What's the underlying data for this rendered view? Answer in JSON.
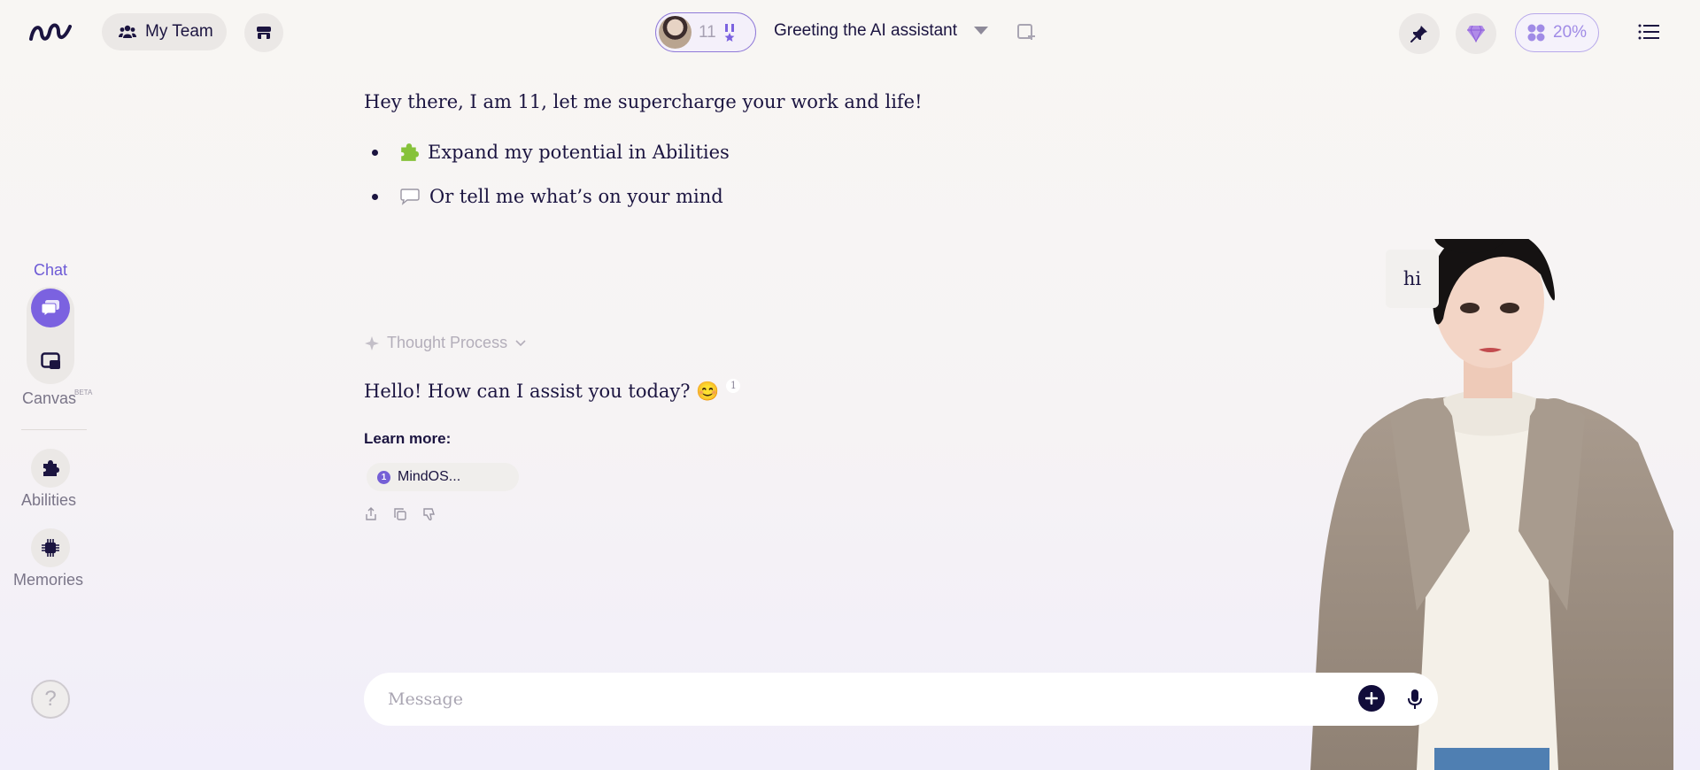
{
  "topbar": {
    "team_label": "My Team",
    "agent_count": "11",
    "conversation_title": "Greeting the AI assistant",
    "credits_percent": "20%"
  },
  "rail": {
    "chat_label": "Chat",
    "canvas_label": "Canvas",
    "canvas_badge": "BETA",
    "abilities_label": "Abilities",
    "memories_label": "Memories",
    "help_label": "?"
  },
  "chat": {
    "greeting": "Hey there, I am 11, let me supercharge your work and life!",
    "bullets": [
      {
        "icon": "puzzle-icon",
        "text": "Expand my potential in Abilities"
      },
      {
        "icon": "speech-bubble-icon",
        "text": "Or tell me what’s on your mind"
      }
    ],
    "thought_process_label": "Thought Process",
    "reply": "Hello! How can I assist you today? 😊",
    "reply_citation": "1",
    "learn_more_label": "Learn more:",
    "sources": [
      {
        "num": "1",
        "label": "MindOS..."
      }
    ]
  },
  "composer": {
    "placeholder": "Message"
  },
  "avatar": {
    "speech": "hi"
  },
  "colors": {
    "accent": "#7b62e0",
    "text": "#1b1440",
    "muted": "#7a7588"
  }
}
